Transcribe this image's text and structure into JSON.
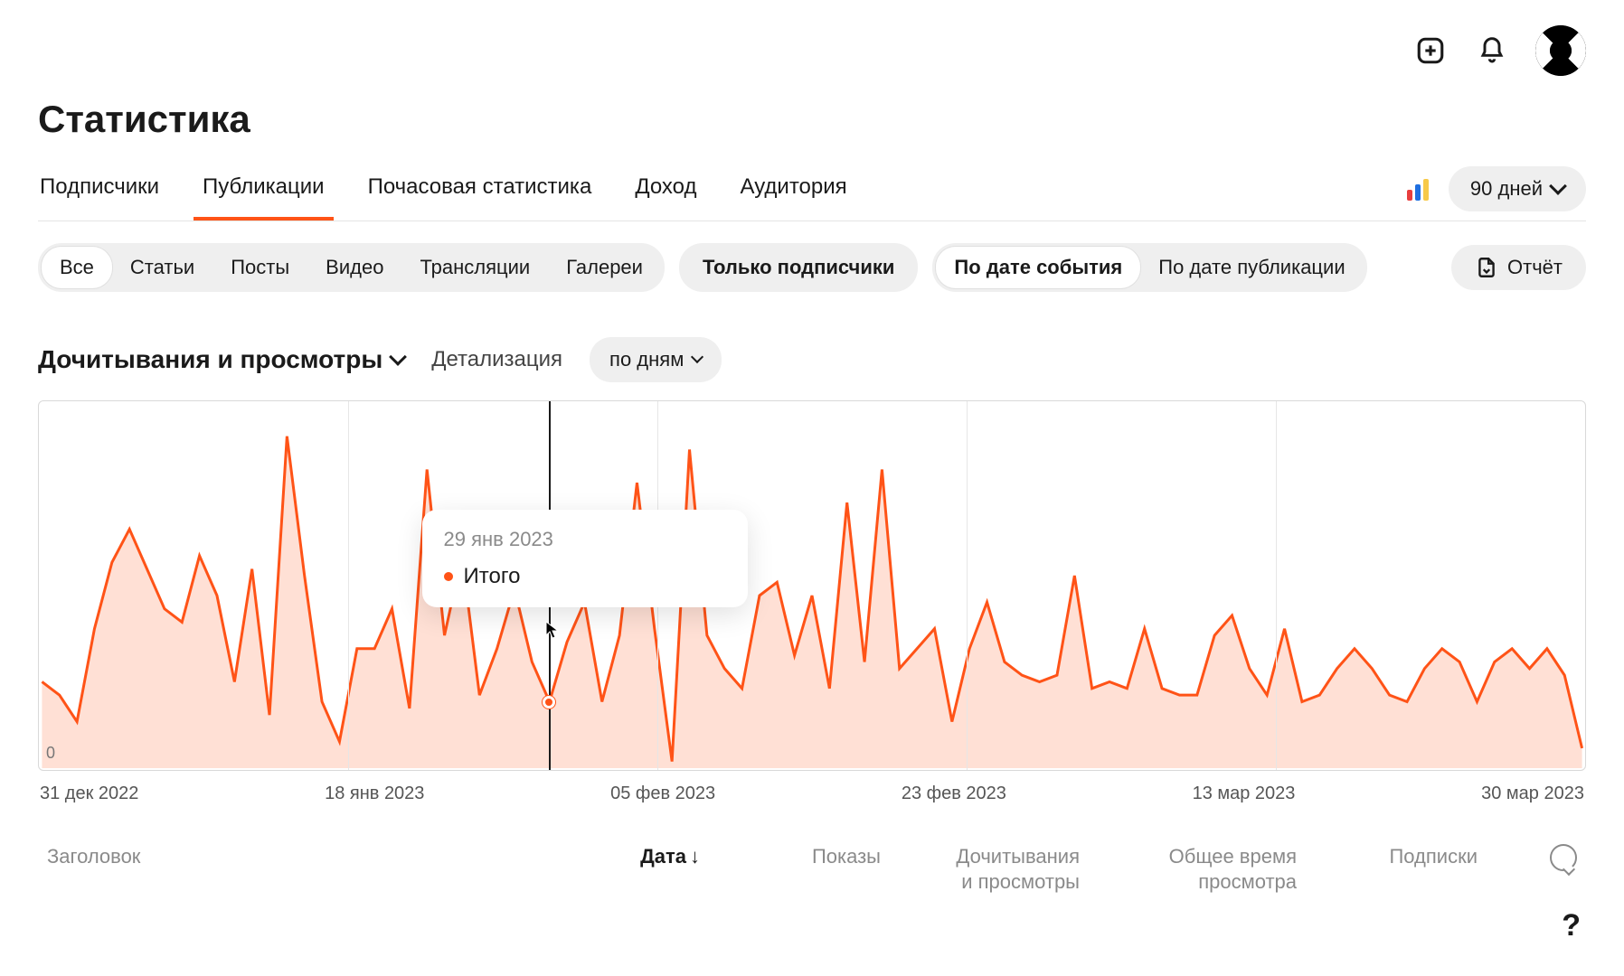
{
  "header": {
    "title": "Статистика",
    "period_label": "90 дней"
  },
  "tabs": [
    {
      "label": "Подписчики",
      "active": false
    },
    {
      "label": "Публикации",
      "active": true
    },
    {
      "label": "Почасовая статистика",
      "active": false
    },
    {
      "label": "Доход",
      "active": false
    },
    {
      "label": "Аудитория",
      "active": false
    }
  ],
  "content_filters": {
    "segments": [
      "Все",
      "Статьи",
      "Посты",
      "Видео",
      "Трансляции",
      "Галереи"
    ],
    "segments_active": "Все",
    "subscribers_only": "Только подписчики",
    "date_mode": {
      "options": [
        "По дате события",
        "По дате публикации"
      ],
      "active": "По дате события"
    },
    "report_button": "Отчёт"
  },
  "chart_controls": {
    "metric": "Дочитывания и просмотры",
    "detail_label": "Детализация",
    "detail_value": "по дням"
  },
  "chart_data": {
    "type": "area",
    "title": "Дочитывания и просмотры",
    "xlabel": "",
    "ylabel": "",
    "ylim": [
      0,
      110
    ],
    "x_ticks": [
      "31 дек 2022",
      "18 янв 2023",
      "05 фев 2023",
      "23 фев 2023",
      "13 мар 2023",
      "30 мар 2023"
    ],
    "x_tick_positions_pct": [
      0,
      20,
      40,
      60,
      80,
      100
    ],
    "grid_vertical_pct": [
      20,
      40,
      60,
      80
    ],
    "series": [
      {
        "name": "Итого",
        "color": "#ff5317",
        "values": [
          26,
          22,
          14,
          42,
          62,
          72,
          60,
          48,
          44,
          64,
          52,
          26,
          60,
          16,
          100,
          58,
          20,
          8,
          36,
          36,
          48,
          18,
          90,
          40,
          64,
          22,
          36,
          54,
          32,
          20,
          38,
          50,
          20,
          40,
          86,
          42,
          2,
          96,
          40,
          30,
          24,
          52,
          56,
          34,
          52,
          24,
          80,
          32,
          90,
          30,
          36,
          42,
          14,
          36,
          50,
          32,
          28,
          26,
          28,
          58,
          24,
          26,
          24,
          42,
          24,
          22,
          22,
          40,
          46,
          30,
          22,
          42,
          20,
          22,
          30,
          36,
          30,
          22,
          20,
          30,
          36,
          32,
          20,
          32,
          36,
          30,
          36,
          28,
          6
        ]
      }
    ],
    "hover": {
      "index": 29,
      "date_label": "29 янв 2023",
      "series_label": "Итого"
    },
    "zero_label": "0"
  },
  "table_columns": [
    {
      "label": "Заголовок",
      "active": false
    },
    {
      "label": "Дата",
      "active": true,
      "sort": "desc"
    },
    {
      "label": "Показы",
      "active": false
    },
    {
      "label": "Дочитывания\nи просмотры",
      "active": false
    },
    {
      "label": "Общее время\nпросмотра",
      "active": false
    },
    {
      "label": "Подписки",
      "active": false
    }
  ],
  "help_label": "?"
}
